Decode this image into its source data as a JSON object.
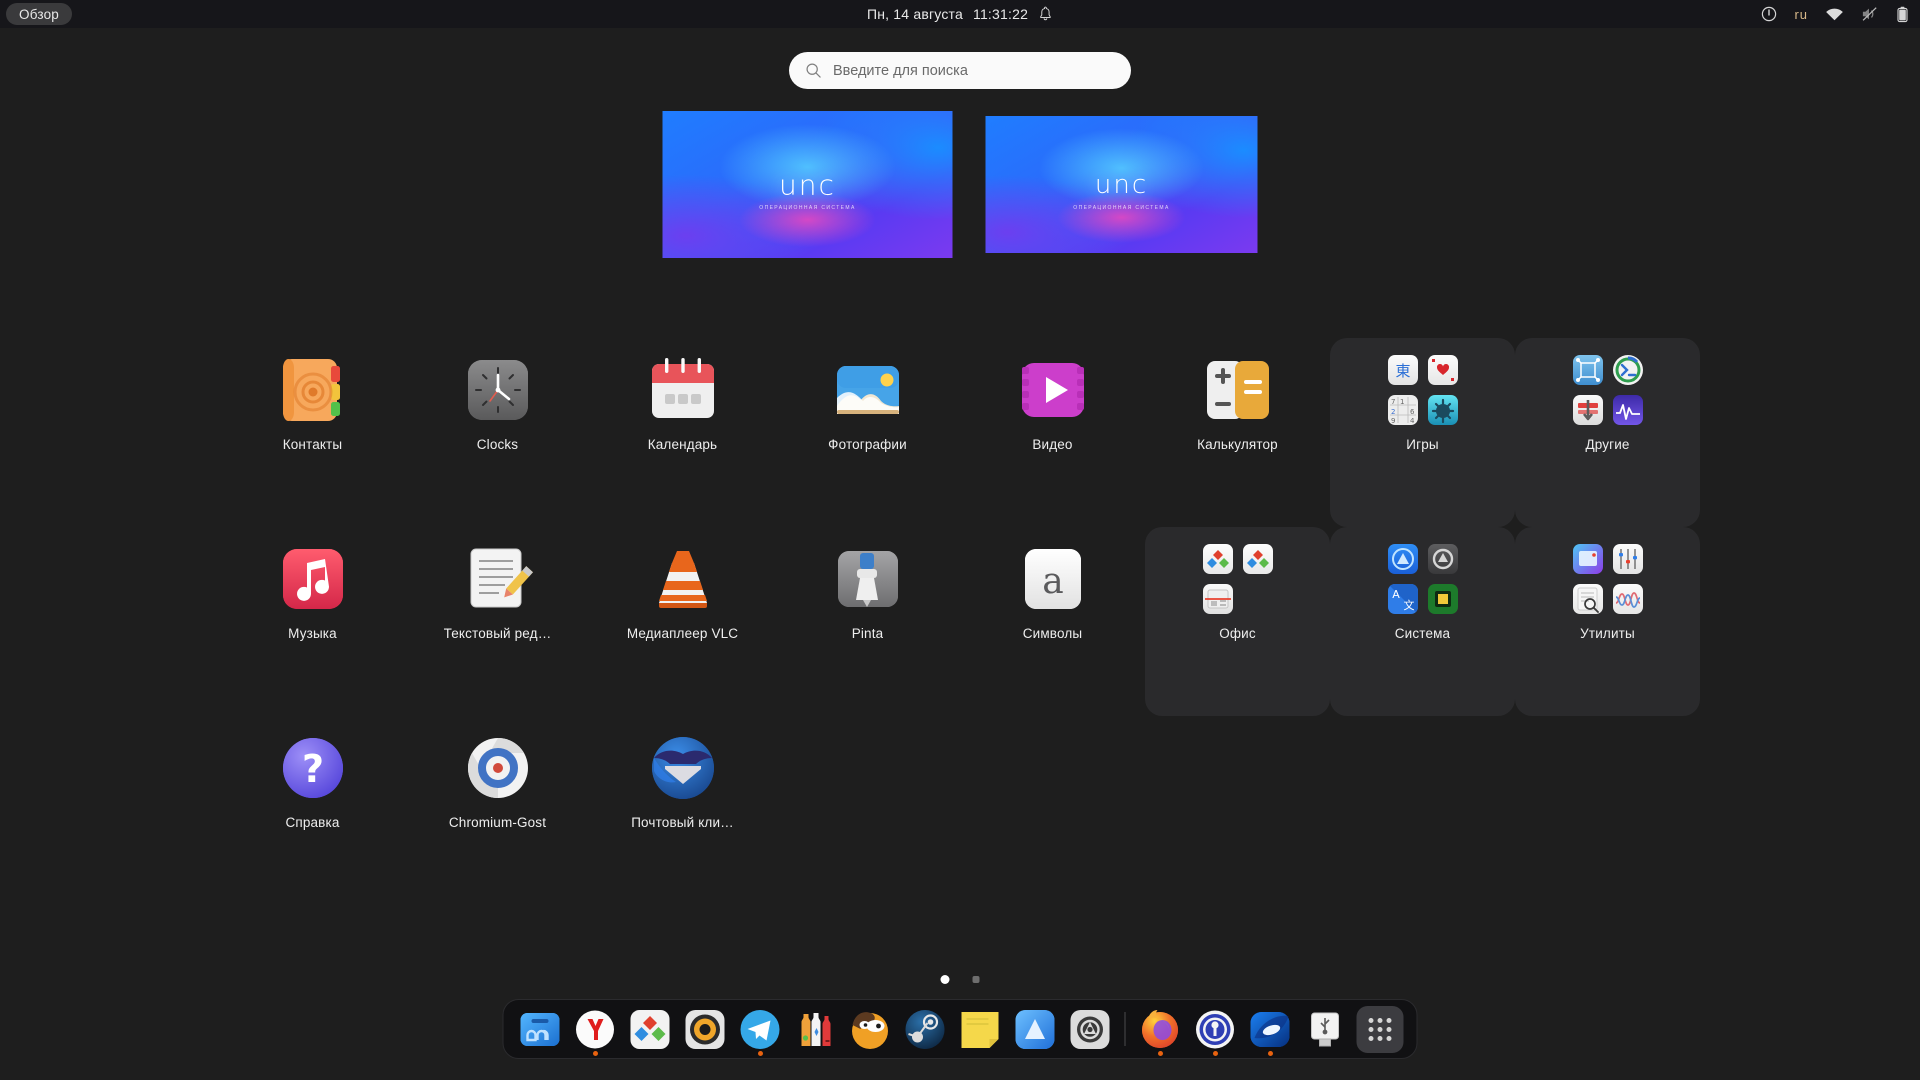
{
  "topbar": {
    "activities_label": "Обзор",
    "date": "Пн, 14 августа",
    "time": "11:31:22",
    "notifications_icon": "bell-icon",
    "power_icon": "power-icon",
    "keyboard_layout": "ru",
    "wifi_icon": "wifi-icon",
    "volume_icon": "volume-muted-icon",
    "battery_icon": "battery-icon",
    "background": "#16161a"
  },
  "search": {
    "placeholder": "Введите для поиска",
    "icon": "search-icon",
    "value": ""
  },
  "workspaces": {
    "items": [
      {
        "name": "workspace-1",
        "active": true,
        "logo": "unc",
        "sub": "ОПЕРАЦИОННАЯ СИСТЕМА"
      },
      {
        "name": "workspace-2",
        "active": false,
        "logo": "unc",
        "sub": "ОПЕРАЦИОННАЯ СИСТЕМА"
      }
    ]
  },
  "app_grid": {
    "rows": [
      [
        {
          "label": "Контакты",
          "icon": "contacts-icon",
          "type": "app"
        },
        {
          "label": "Clocks",
          "icon": "clocks-icon",
          "type": "app"
        },
        {
          "label": "Календарь",
          "icon": "calendar-icon",
          "type": "app"
        },
        {
          "label": "Фотографии",
          "icon": "photos-icon",
          "type": "app"
        },
        {
          "label": "Видео",
          "icon": "videos-icon",
          "type": "app"
        },
        {
          "label": "Калькулятор",
          "icon": "calculator-icon",
          "type": "app"
        },
        {
          "label": "Игры",
          "icon": "folder-games",
          "type": "folder",
          "contents": [
            "mahjong-icon",
            "cards-icon",
            "sudoku-icon",
            "mines-icon"
          ]
        },
        {
          "label": "Другие",
          "icon": "folder-other",
          "type": "folder",
          "contents": [
            "boxes-icon",
            "remote-desktop-icon",
            "disk-usage-icon",
            "system-monitor-icon"
          ]
        }
      ],
      [
        {
          "label": "Музыка",
          "icon": "music-icon",
          "type": "app"
        },
        {
          "label": "Текстовый ред…",
          "icon": "text-editor-icon",
          "type": "app"
        },
        {
          "label": "Медиаплеер VLC",
          "icon": "vlc-icon",
          "type": "app"
        },
        {
          "label": "Pinta",
          "icon": "pinta-icon",
          "type": "app"
        },
        {
          "label": "Символы",
          "icon": "characters-icon",
          "type": "app"
        },
        {
          "label": "Офис",
          "icon": "folder-office",
          "type": "folder",
          "contents": [
            "onlyoffice-docs-icon",
            "onlyoffice-sheets-icon",
            "scanner-icon",
            ""
          ]
        },
        {
          "label": "Система",
          "icon": "folder-system",
          "type": "folder",
          "contents": [
            "astra-icon",
            "settings-dark-icon",
            "translate-icon",
            "cpu-icon"
          ]
        },
        {
          "label": "Утилиты",
          "icon": "folder-utils",
          "type": "folder",
          "contents": [
            "screenshot-icon",
            "equalizer-icon",
            "search-docs-icon",
            "waveform-icon"
          ]
        }
      ],
      [
        {
          "label": "Справка",
          "icon": "help-icon",
          "type": "app"
        },
        {
          "label": "Chromium-Gost",
          "icon": "chromium-icon",
          "type": "app"
        },
        {
          "label": "Почтовый кли…",
          "icon": "thunderbird-icon",
          "type": "app"
        }
      ]
    ]
  },
  "pages": {
    "count": 2,
    "active": 0
  },
  "dock": {
    "items": [
      {
        "name": "files",
        "icon": "unc-files-icon",
        "running": false
      },
      {
        "name": "yandex",
        "icon": "yandex-icon",
        "running": true
      },
      {
        "name": "onlyoffice",
        "icon": "onlyoffice-icon",
        "running": false
      },
      {
        "name": "audio",
        "icon": "audio-player-icon",
        "running": false
      },
      {
        "name": "telegram",
        "icon": "telegram-icon",
        "running": true
      },
      {
        "name": "bottles",
        "icon": "bottles-icon",
        "running": false
      },
      {
        "name": "gimp",
        "icon": "gimp-icon",
        "running": false
      },
      {
        "name": "steam",
        "icon": "steam-icon",
        "running": false
      },
      {
        "name": "notes",
        "icon": "sticky-notes-icon",
        "running": false
      },
      {
        "name": "astra",
        "icon": "astra-icon",
        "running": false
      },
      {
        "name": "settings",
        "icon": "settings-icon",
        "running": false
      },
      {
        "name": "separator",
        "icon": "separator",
        "running": false
      },
      {
        "name": "firefox",
        "icon": "firefox-icon",
        "running": true
      },
      {
        "name": "keepass",
        "icon": "keepass-icon",
        "running": true
      },
      {
        "name": "bluejeans",
        "icon": "blue-app-icon",
        "running": true
      },
      {
        "name": "usb-drive",
        "icon": "usb-drive-icon",
        "running": false
      },
      {
        "name": "show-apps",
        "icon": "app-grid-icon",
        "running": false
      }
    ]
  },
  "colors": {
    "desktop_bg": "#1e1e1e",
    "topbar_bg": "#16161a",
    "accent": "#3584e4",
    "running_dot": "#e8620f"
  }
}
